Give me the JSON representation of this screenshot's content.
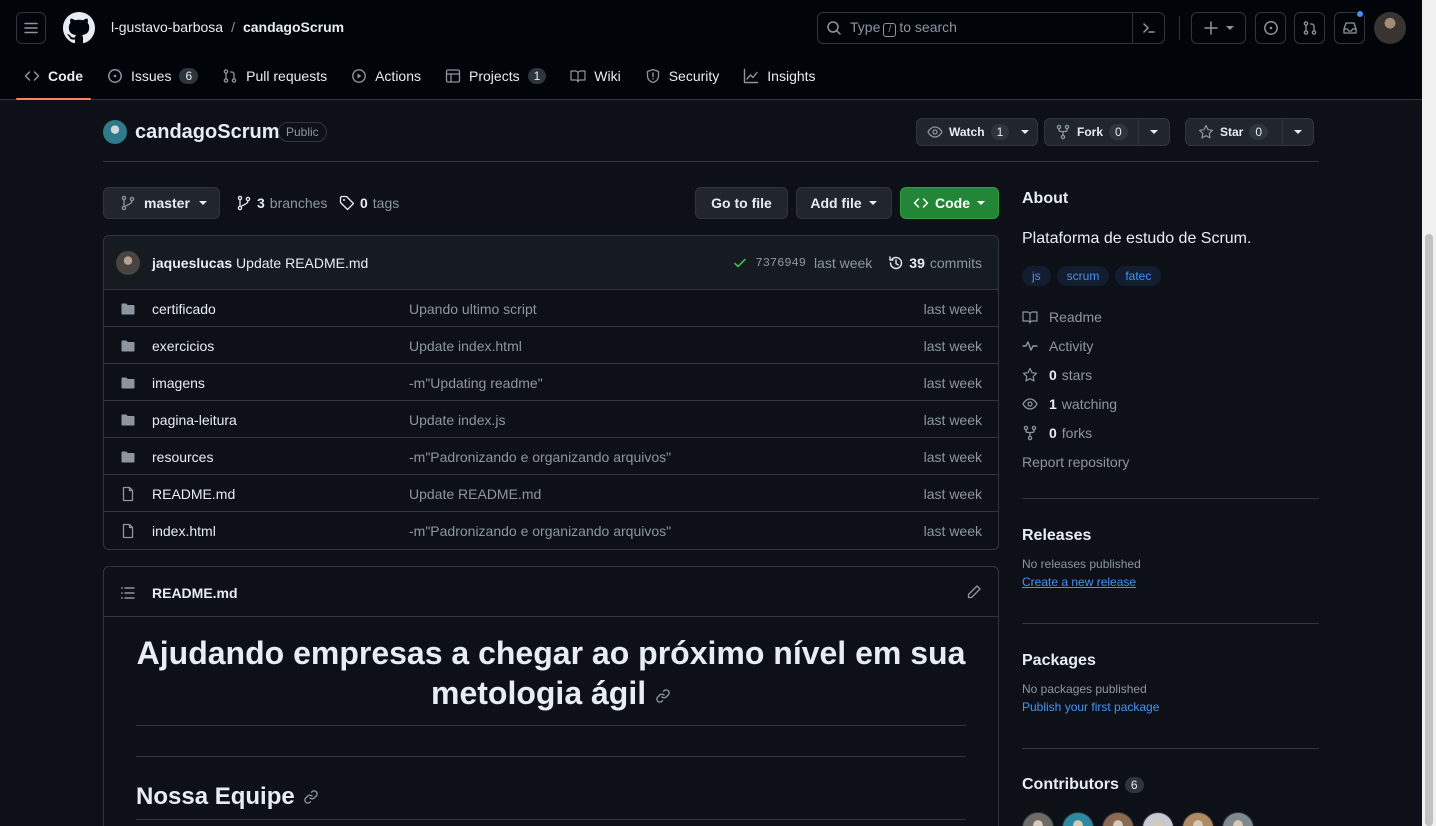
{
  "header": {
    "owner": "l-gustavo-barbosa",
    "separator": "/",
    "repo": "candagoScrum",
    "search": {
      "prefix": "Type",
      "key": "/",
      "suffix": "to search"
    }
  },
  "tabs": [
    {
      "label": "Code",
      "icon": "code-icon",
      "counter": null,
      "active": true
    },
    {
      "label": "Issues",
      "icon": "issue-icon",
      "counter": "6",
      "active": false
    },
    {
      "label": "Pull requests",
      "icon": "pull-request-icon",
      "counter": null,
      "active": false
    },
    {
      "label": "Actions",
      "icon": "play-icon",
      "counter": null,
      "active": false
    },
    {
      "label": "Projects",
      "icon": "table-icon",
      "counter": "1",
      "active": false
    },
    {
      "label": "Wiki",
      "icon": "book-icon",
      "counter": null,
      "active": false
    },
    {
      "label": "Security",
      "icon": "shield-icon",
      "counter": null,
      "active": false
    },
    {
      "label": "Insights",
      "icon": "graph-icon",
      "counter": null,
      "active": false
    }
  ],
  "repo_head": {
    "name": "candagoScrum",
    "visibility": "Public",
    "watch": {
      "label": "Watch",
      "count": "1"
    },
    "fork": {
      "label": "Fork",
      "count": "0"
    },
    "star": {
      "label": "Star",
      "count": "0"
    }
  },
  "file_nav": {
    "branch": "master",
    "branches_count": "3",
    "branches_label": "branches",
    "tags_count": "0",
    "tags_label": "tags",
    "go_to_file": "Go to file",
    "add_file": "Add file",
    "code": "Code"
  },
  "last_commit": {
    "author": "jaqueslucas",
    "message": "Update README.md",
    "sha": "7376949",
    "time": "last week",
    "commits_count": "39",
    "commits_label": "commits"
  },
  "files": [
    {
      "name": "certificado",
      "type": "folder",
      "message": "Upando ultimo script",
      "date": "last week"
    },
    {
      "name": "exercicios",
      "type": "folder",
      "message": "Update index.html",
      "date": "last week"
    },
    {
      "name": "imagens",
      "type": "folder",
      "message": "-m\"Updating readme\"",
      "date": "last week"
    },
    {
      "name": "pagina-leitura",
      "type": "folder",
      "message": "Update index.js",
      "date": "last week"
    },
    {
      "name": "resources",
      "type": "folder",
      "message": "-m\"Padronizando e organizando arquivos\"",
      "date": "last week"
    },
    {
      "name": "README.md",
      "type": "file",
      "message": "Update README.md",
      "date": "last week"
    },
    {
      "name": "index.html",
      "type": "file",
      "message": "-m\"Padronizando e organizando arquivos\"",
      "date": "last week"
    }
  ],
  "readme": {
    "filename": "README.md",
    "h1": "Ajudando empresas a chegar ao próximo nível em sua metologia ágil",
    "h2": "Nossa Equipe"
  },
  "about": {
    "title": "About",
    "description": "Plataforma de estudo de Scrum.",
    "topics": [
      "js",
      "scrum",
      "fatec"
    ],
    "readme": "Readme",
    "activity": "Activity",
    "stars_count": "0",
    "stars_label": "stars",
    "watching_count": "1",
    "watching_label": "watching",
    "forks_count": "0",
    "forks_label": "forks",
    "report": "Report repository"
  },
  "releases": {
    "title": "Releases",
    "empty": "No releases published",
    "link": "Create a new release"
  },
  "packages": {
    "title": "Packages",
    "empty": "No packages published",
    "link": "Publish your first package"
  },
  "contributors": {
    "title": "Contributors",
    "count": "6",
    "avatar_colors": [
      "#6e6a66",
      "#2c8aa0",
      "#8a6a50",
      "#c8c8d0",
      "#b08a60",
      "#808890"
    ]
  },
  "colors": {
    "accent_tab": "#f78166",
    "green_button": "#238636",
    "link": "#4493f8",
    "background": "#0d1117"
  }
}
